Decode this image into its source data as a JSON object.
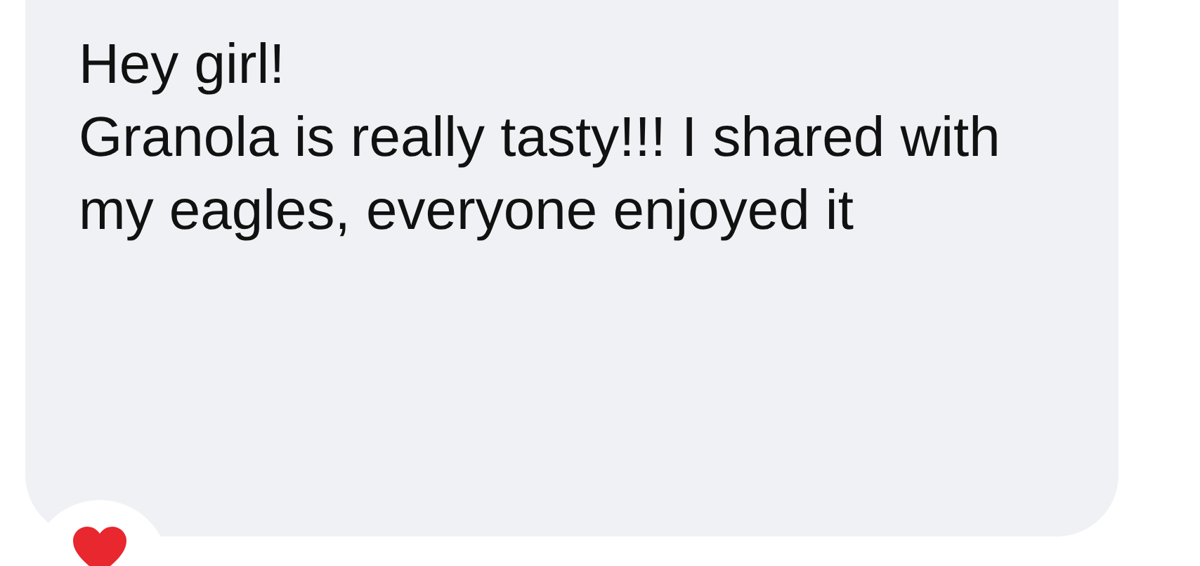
{
  "message": {
    "paragraphs": [
      "Hey girl!",
      "Granola is really tasty!!! I shared with my eagles, everyone enjoyed it"
    ],
    "reaction": {
      "kind": "heart"
    }
  }
}
